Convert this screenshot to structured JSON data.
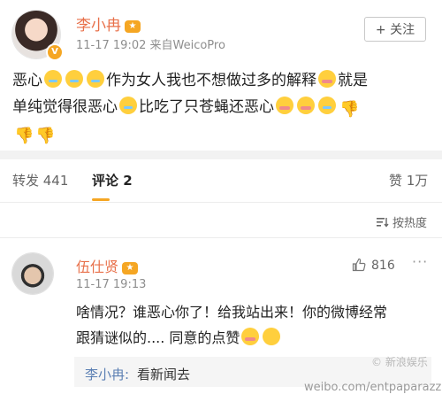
{
  "post": {
    "author_name": "李小冉",
    "meta": "11-17 19:02  来自WeicoPro",
    "follow_label": "+ 关注",
    "text_line1_a": "恶心",
    "text_line1_b": "作为女人我也不想做过多的解释",
    "text_line1_c": "就是",
    "text_line2_a": "单纯觉得很恶心",
    "text_line2_b": "比吃了只苍蝇还恶心"
  },
  "tabs": [
    {
      "label": "转发 441"
    },
    {
      "label": "评论 2"
    },
    {
      "label": "赞 1万"
    }
  ],
  "sort_label": "按热度",
  "comment": {
    "author_name": "伍仕贤",
    "time": "11-17 19:13",
    "like_count": "816",
    "text_line1": "啥情况？谁恶心你了！给我站出来！你的微博经常",
    "text_line2": "跟猜谜似的.... 同意的点赞",
    "reply_name": "李小冉:",
    "reply_text": "看新闻去"
  },
  "watermark": {
    "top": "新浪娱乐",
    "bottom": "weibo.com/entpaparazzi"
  },
  "colors": {
    "name": "#e8704a",
    "accent": "#f5a623",
    "link": "#5b7fb3"
  }
}
